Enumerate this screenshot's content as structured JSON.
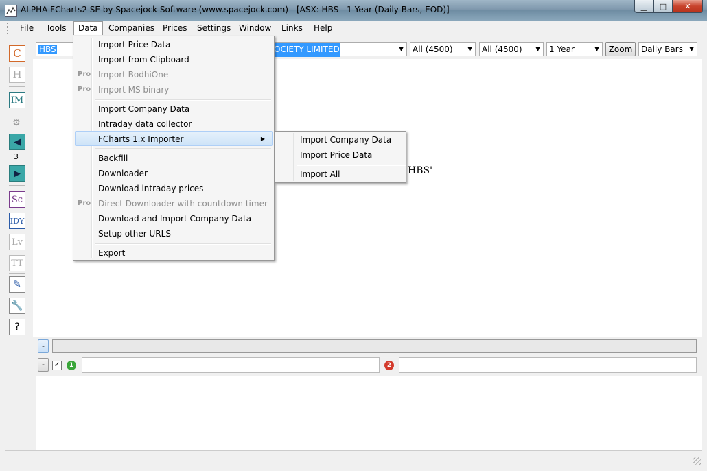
{
  "window": {
    "title": "ALPHA FCharts2 SE by Spacejock Software (www.spacejock.com) - [ASX: HBS - 1 Year (Daily Bars, EOD)]",
    "minimize": "▁",
    "maximize": "□",
    "close": "✕"
  },
  "menubar": [
    "File",
    "Tools",
    "Data",
    "Companies",
    "Prices",
    "Settings",
    "Window",
    "Links",
    "Help"
  ],
  "left_toolbar": {
    "c": "C",
    "h": "H",
    "im": "IM",
    "page_number": "3",
    "sc": "Sc",
    "idy": "IDY",
    "lv": "Lv",
    "tt": "TT",
    "help": "?"
  },
  "toolbar": {
    "ticker": "HBS",
    "company": "OCIETY LIMITED",
    "filter1": "All (4500)",
    "filter2": "All (4500)",
    "period": "1 Year",
    "zoom": "Zoom",
    "bars": "Daily Bars"
  },
  "main": {
    "message_fragment": "HBS'"
  },
  "bottom": {
    "collapse1": "-",
    "collapse2": "-",
    "marker1": "1",
    "marker2": "2"
  },
  "data_menu": {
    "items": [
      {
        "label": "Import Price Data",
        "pro": "",
        "enabled": true
      },
      {
        "label": "Import from Clipboard",
        "pro": "",
        "enabled": true
      },
      {
        "label": "Import BodhiOne",
        "pro": "Pro",
        "enabled": false
      },
      {
        "label": "Import MS binary",
        "pro": "Pro",
        "enabled": false
      },
      {
        "label": "Import Company Data",
        "pro": "",
        "enabled": true
      },
      {
        "label": "Intraday data collector",
        "pro": "",
        "enabled": true
      },
      {
        "label": "FCharts 1.x Importer",
        "pro": "",
        "enabled": true,
        "submenu": true
      },
      {
        "label": "Backfill",
        "pro": "",
        "enabled": true
      },
      {
        "label": "Downloader",
        "pro": "",
        "enabled": true
      },
      {
        "label": "Download intraday prices",
        "pro": "",
        "enabled": true
      },
      {
        "label": "Direct Downloader with countdown timer",
        "pro": "Pro",
        "enabled": false
      },
      {
        "label": "Download and Import Company Data",
        "pro": "",
        "enabled": true
      },
      {
        "label": "Setup other URLS",
        "pro": "",
        "enabled": true
      },
      {
        "label": "Export",
        "pro": "",
        "enabled": true
      }
    ]
  },
  "submenu": {
    "items": [
      "Import Company Data",
      "Import Price Data",
      "Import All"
    ]
  },
  "colors": {
    "selection": "#3399ff",
    "menu_highlight": "#cde3f8",
    "marker_green": "#3aa63a",
    "marker_red": "#d33a2c"
  }
}
